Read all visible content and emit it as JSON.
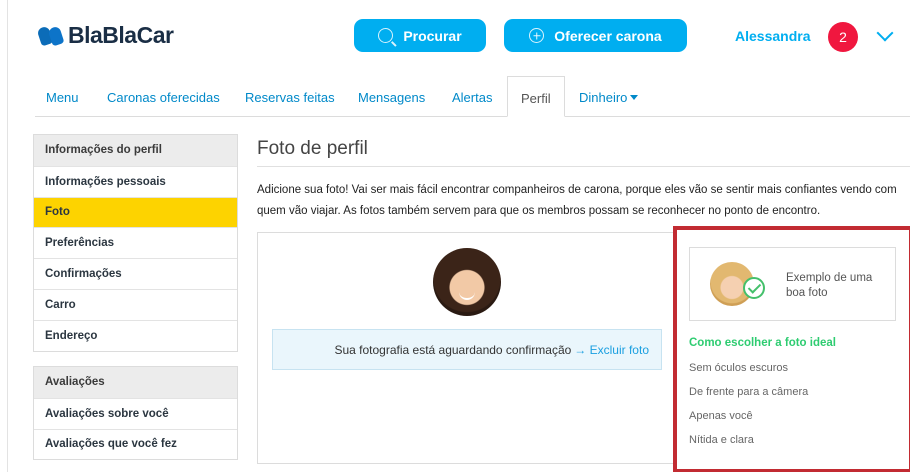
{
  "header": {
    "logo_text": "BlaBlaCar",
    "search_label": "Procurar",
    "offer_label": "Oferecer carona",
    "username": "Alessandra",
    "notification_count": "2"
  },
  "tabs": [
    {
      "label": "Menu"
    },
    {
      "label": "Caronas oferecidas"
    },
    {
      "label": "Reservas feitas"
    },
    {
      "label": "Mensagens"
    },
    {
      "label": "Alertas"
    },
    {
      "label": "Perfil"
    },
    {
      "label": "Dinheiro"
    }
  ],
  "sidebar": {
    "profile_group": [
      "Informações do perfil",
      "Informações pessoais",
      "Foto",
      "Preferências",
      "Confirmações",
      "Carro",
      "Endereço"
    ],
    "ratings_group": [
      "Avaliações",
      "Avaliações sobre você",
      "Avaliações que você fez"
    ]
  },
  "main": {
    "title": "Foto de perfil",
    "intro": "Adicione sua foto! Vai ser mais fácil encontrar companheiros de carona, porque eles vão se sentir mais confiantes vendo com quem vão viajar. As fotos também servem para que os membros possam se reconhecer no ponto de encontro.",
    "status_text": "Sua fotografia está aguardando confirmação",
    "delete_link": "→ Excluir foto"
  },
  "tips": {
    "example_label": "Exemplo de uma boa foto",
    "heading": "Como escolher a foto ideal",
    "items": [
      "Sem óculos escuros",
      "De frente para a câmera",
      "Apenas você",
      "Nítida e clara"
    ]
  },
  "colors": {
    "accent": "#00aef0",
    "active_sidebar": "#fdd300",
    "badge": "#f0173f",
    "tip_heading": "#2ecc71",
    "highlight_border": "#c22b32"
  }
}
